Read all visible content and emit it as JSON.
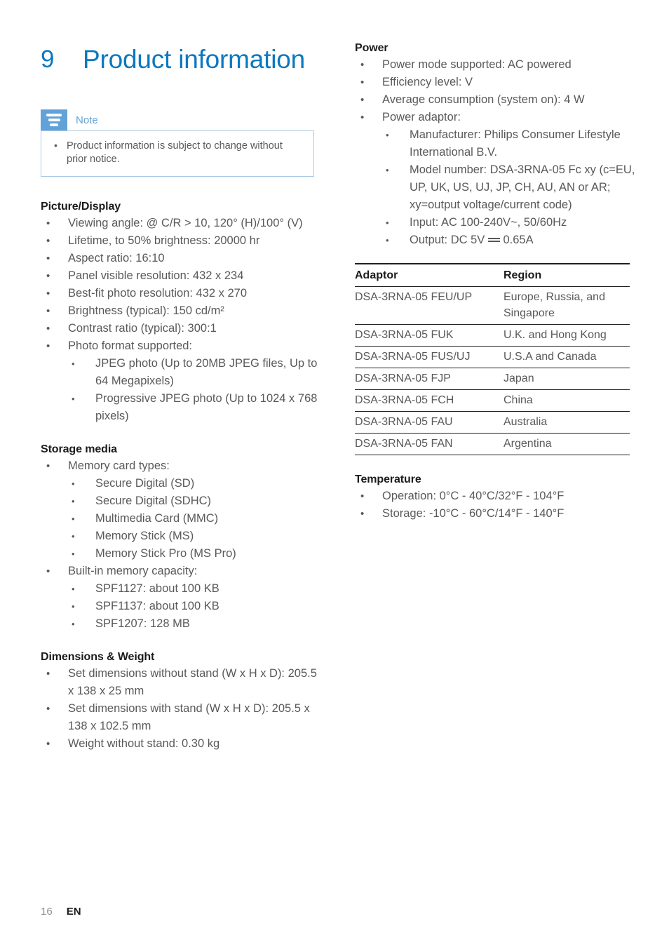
{
  "chapter": {
    "number": "9",
    "title": "Product information"
  },
  "note": {
    "label": "Note",
    "items": [
      "Product information is subject to change without prior notice."
    ]
  },
  "colors": {
    "heading_blue": "#0b78bf",
    "note_blue": "#62a2d8",
    "note_border": "#a9cbe8",
    "body_gray": "#58595b",
    "dark": "#1b1b1b",
    "page_number_gray": "#8d8e90"
  },
  "sections": {
    "picture_display": {
      "heading": "Picture/Display",
      "items": [
        "Viewing angle: @ C/R > 10, 120° (H)/100° (V)",
        "Lifetime, to 50% brightness: 20000 hr",
        "Aspect ratio: 16:10",
        "Panel visible resolution: 432 x 234",
        "Best-fit photo resolution: 432 x 270",
        "Brightness (typical): 150 cd/m²",
        "Contrast ratio (typical): 300:1",
        "Photo format supported:"
      ],
      "photo_formats": [
        "JPEG photo (Up to 20MB JPEG files, Up to 64 Megapixels)",
        "Progressive JPEG photo (Up to 1024 x 768 pixels)"
      ]
    },
    "storage_media": {
      "heading": "Storage media",
      "card_types_label": "Memory card types:",
      "card_types": [
        "Secure Digital (SD)",
        "Secure Digital (SDHC)",
        "Multimedia Card (MMC)",
        "Memory Stick (MS)",
        "Memory Stick Pro (MS Pro)"
      ],
      "builtin_label": "Built-in memory capacity:",
      "builtin": [
        "SPF1127: about 100 KB",
        "SPF1137: about 100 KB",
        "SPF1207: 128 MB"
      ]
    },
    "dimensions_weight": {
      "heading": "Dimensions & Weight",
      "items": [
        "Set dimensions without stand (W x H x D): 205.5 x 138 x 25 mm",
        "Set dimensions with stand (W x H x D): 205.5 x 138 x 102.5 mm",
        "Weight without stand: 0.30 kg"
      ]
    },
    "power": {
      "heading": "Power",
      "items": [
        "Power mode supported: AC powered",
        "Efficiency level: V",
        "Average consumption (system on): 4 W",
        "Power adaptor:"
      ],
      "adaptor_details": [
        "Manufacturer: Philips Consumer Lifestyle International B.V.",
        "Model number: DSA-3RNA-05 Fc xy (c=EU, UP, UK, US, UJ, JP, CH, AU, AN or AR; xy=output voltage/current code)",
        "Input: AC 100-240V~, 50/60Hz"
      ],
      "output_prefix": "Output: DC 5V ",
      "output_suffix": " 0.65A",
      "dc_symbol_name": "direct-current-icon"
    },
    "temperature": {
      "heading": "Temperature",
      "items": [
        "Operation: 0°C - 40°C/32°F - 104°F",
        "Storage: -10°C - 60°C/14°F - 140°F"
      ]
    }
  },
  "adaptor_table": {
    "headers": [
      "Adaptor",
      "Region"
    ],
    "rows": [
      [
        "DSA-3RNA-05 FEU/UP",
        "Europe, Russia, and Singapore"
      ],
      [
        "DSA-3RNA-05 FUK",
        "U.K. and Hong Kong"
      ],
      [
        "DSA-3RNA-05 FUS/UJ",
        "U.S.A and Canada"
      ],
      [
        "DSA-3RNA-05 FJP",
        "Japan"
      ],
      [
        "DSA-3RNA-05 FCH",
        "China"
      ],
      [
        "DSA-3RNA-05 FAU",
        "Australia"
      ],
      [
        "DSA-3RNA-05 FAN",
        "Argentina"
      ]
    ]
  },
  "footer": {
    "page_number": "16",
    "language": "EN"
  }
}
